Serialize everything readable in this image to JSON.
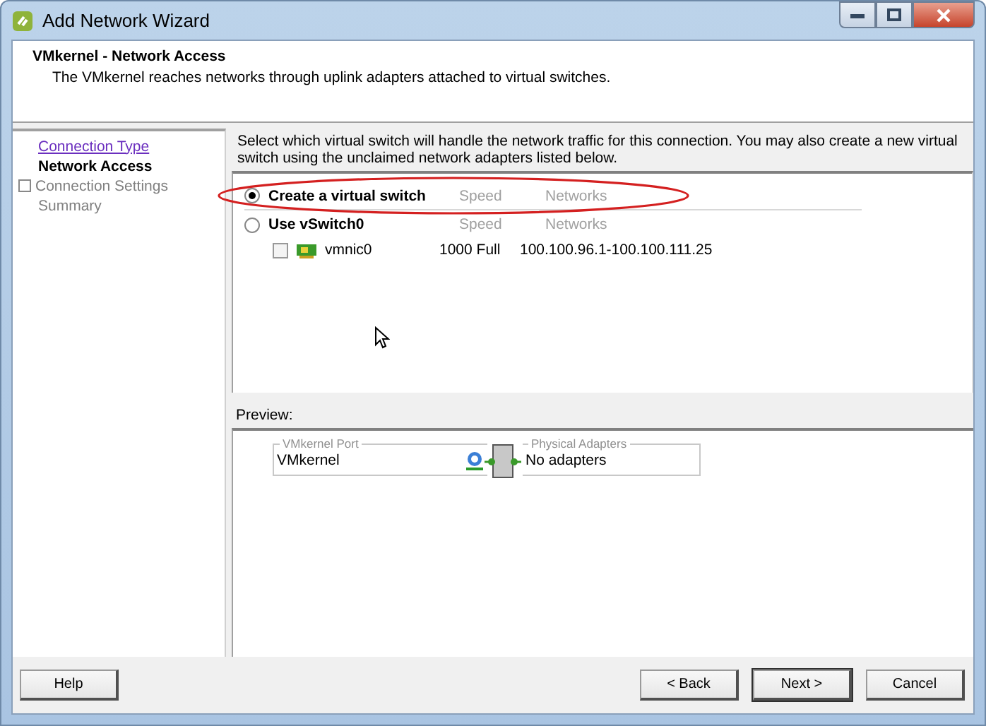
{
  "window": {
    "title": "Add Network Wizard"
  },
  "header": {
    "title": "VMkernel - Network Access",
    "description": "The VMkernel reaches networks through uplink adapters attached to virtual switches."
  },
  "steps": [
    {
      "label": "Connection Type",
      "kind": "visited"
    },
    {
      "label": "Network Access",
      "kind": "current"
    },
    {
      "label": "Connection Settings",
      "kind": "group"
    },
    {
      "label": "Summary",
      "kind": "pending"
    }
  ],
  "instructions": "Select which virtual switch will handle the network traffic for this connection. You may also create a new virtual switch using the unclaimed network adapters listed below.",
  "switch_options": [
    {
      "label": "Create a virtual switch",
      "selected": true,
      "speed_header": "Speed",
      "networks_header": "Networks",
      "highlighted": true
    },
    {
      "label": "Use vSwitch0",
      "selected": false,
      "speed_header": "Speed",
      "networks_header": "Networks",
      "highlighted": false,
      "adapters": [
        {
          "name": "vmnic0",
          "checked": false,
          "speed": "1000 Full",
          "networks": "100.100.96.1-100.100.111.25"
        }
      ]
    }
  ],
  "preview": {
    "label": "Preview:",
    "port_legend": "VMkernel Port",
    "port_name": "VMkernel",
    "adapters_legend": "Physical Adapters",
    "adapters_text": "No adapters"
  },
  "buttons": [
    {
      "label": "Help",
      "kind": "left",
      "default": false
    },
    {
      "label": "< Back",
      "kind": "right",
      "default": false
    },
    {
      "label": "Next >",
      "kind": "right",
      "default": true
    },
    {
      "label": "Cancel",
      "kind": "right",
      "default": false
    }
  ]
}
